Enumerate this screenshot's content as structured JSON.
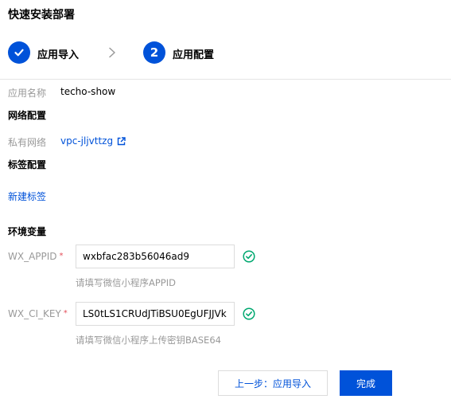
{
  "header": {
    "title": "快速安装部署"
  },
  "steps": [
    {
      "number": "",
      "label": "应用导入",
      "status": "done"
    },
    {
      "number": "2",
      "label": "应用配置",
      "status": "current"
    }
  ],
  "app": {
    "name_label": "应用名称",
    "name_value": "techo-show"
  },
  "network": {
    "section_title": "网络配置",
    "vpc_label": "私有网络",
    "vpc_value": "vpc-jljvttzg"
  },
  "tags": {
    "section_title": "标签配置",
    "new_tag_link": "新建标签"
  },
  "env": {
    "section_title": "环境变量",
    "fields": [
      {
        "label": "WX_APPID",
        "value": "wxbfac283b56046ad9",
        "hint": "请填写微信小程序APPID"
      },
      {
        "label": "WX_CI_KEY",
        "value": "LS0tLS1CRUdJTiBSU0EgUFJJVk",
        "hint": "请填写微信小程序上传密钥BASE64"
      }
    ]
  },
  "actions": {
    "prev_label": "上一步：应用导入",
    "finish_label": "完成"
  },
  "colors": {
    "primary": "#0052d9",
    "success": "#00a870",
    "required": "#e34d59"
  }
}
